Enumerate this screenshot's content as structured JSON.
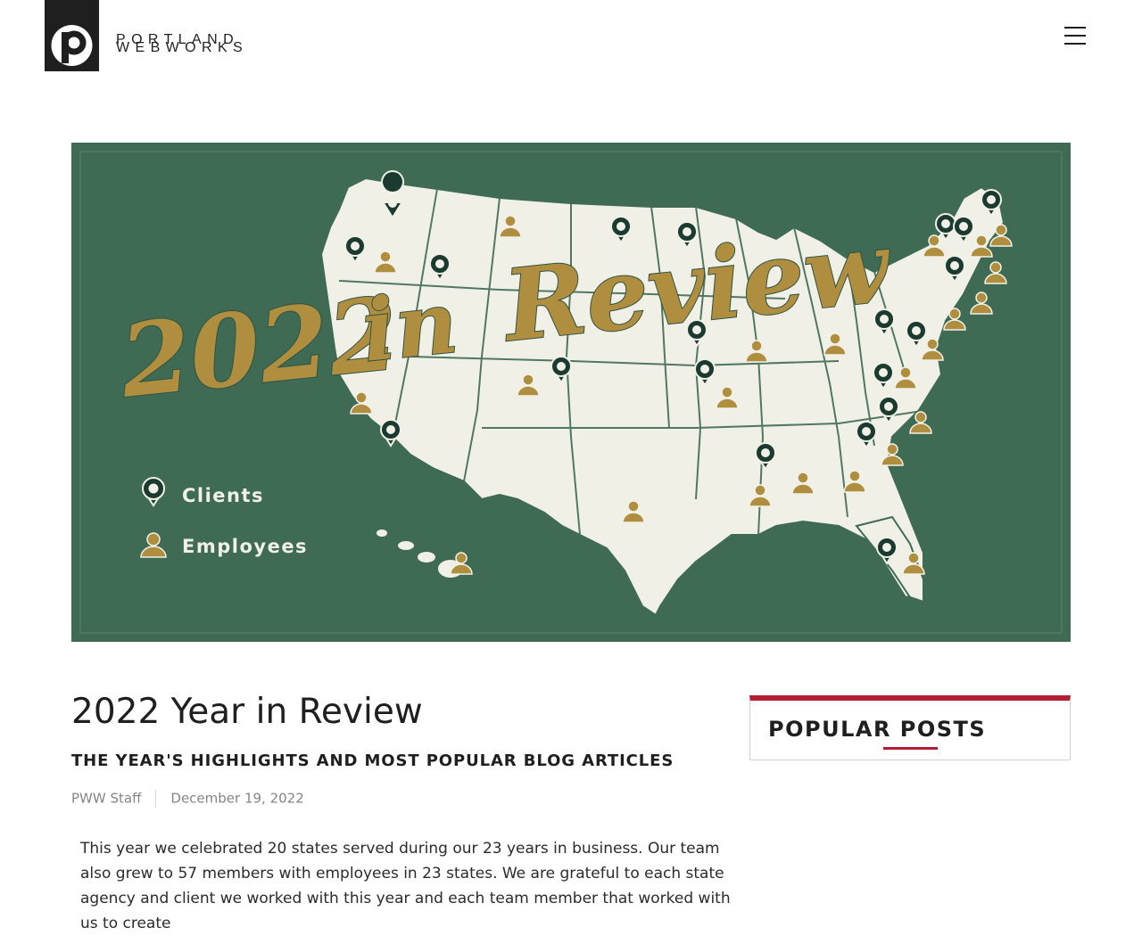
{
  "header": {
    "logo_letter": "P",
    "brand_line1": "PORTLAND",
    "brand_line2": "WEBWORKS",
    "menu_icon": "hamburger-menu-icon"
  },
  "hero": {
    "script_title_year": "2022",
    "script_title_in": "in",
    "script_title_review": "Review",
    "legend_clients": "Clients",
    "legend_employees": "Employees",
    "background_color": "#3f6b54",
    "map_color": "#f1f0e6",
    "accent_gold": "#b08e3f",
    "pin_color": "#1b3a30"
  },
  "article": {
    "title": "2022 Year in Review",
    "subtitle": "THE YEAR'S HIGHLIGHTS AND MOST POPULAR BLOG ARTICLES",
    "author": "PWW Staff",
    "date": "December 19, 2022",
    "body": "This year we celebrated 20 states served during our 23 years in business. Our team also grew to 57 members with employees in 23 states. We are grateful to each state agency and client we worked with this year and each team member that worked with us to create"
  },
  "sidebar": {
    "popular_posts_title": "POPULAR POSTS",
    "accent_color": "#b01f34"
  }
}
